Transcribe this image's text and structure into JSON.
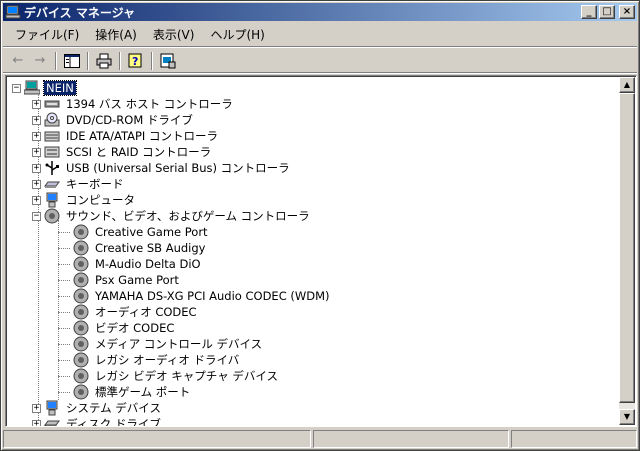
{
  "window": {
    "title": "デバイス マネージャ"
  },
  "menu": [
    {
      "label": "ファイル(F)"
    },
    {
      "label": "操作(A)"
    },
    {
      "label": "表示(V)"
    },
    {
      "label": "ヘルプ(H)"
    }
  ],
  "tree": {
    "root": "NEIN",
    "categories": [
      {
        "label": "1394 バス ホスト コントローラ",
        "icon": "bus-controller-icon"
      },
      {
        "label": "DVD/CD-ROM ドライブ",
        "icon": "cdrom-icon"
      },
      {
        "label": "IDE ATA/ATAPI コントローラ",
        "icon": "ide-controller-icon"
      },
      {
        "label": "SCSI と RAID コントローラ",
        "icon": "scsi-controller-icon"
      },
      {
        "label": "USB (Universal Serial Bus) コントローラ",
        "icon": "usb-icon"
      },
      {
        "label": "キーボード",
        "icon": "keyboard-icon"
      },
      {
        "label": "コンピュータ",
        "icon": "computer-icon"
      },
      {
        "label": "サウンド、ビデオ、およびゲーム コントローラ",
        "icon": "sound-icon",
        "expanded": true
      },
      {
        "label": "システム デバイス",
        "icon": "system-device-icon"
      },
      {
        "label": "ディスク ドライブ",
        "icon": "disk-drive-icon"
      }
    ],
    "sound_children": [
      "Creative Game Port",
      "Creative SB Audigy",
      "M-Audio Delta DiO",
      "Psx Game Port",
      "YAMAHA DS-XG PCI Audio CODEC (WDM)",
      "オーディオ CODEC",
      "ビデオ CODEC",
      "メディア コントロール デバイス",
      "レガシ オーディオ ドライバ",
      "レガシ ビデオ キャプチャ デバイス",
      "標準ゲーム ポート"
    ]
  }
}
